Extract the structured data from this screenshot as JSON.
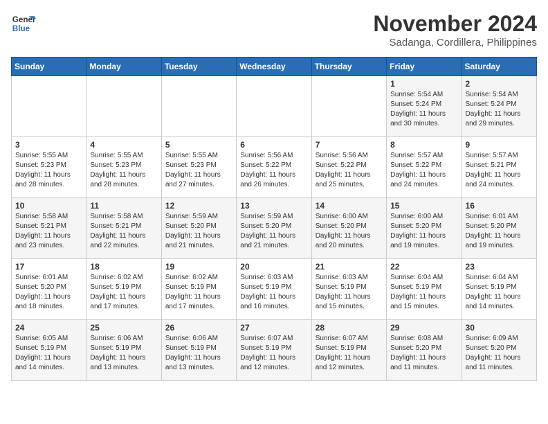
{
  "header": {
    "logo_line1": "General",
    "logo_line2": "Blue",
    "month": "November 2024",
    "location": "Sadanga, Cordillera, Philippines"
  },
  "days_of_week": [
    "Sunday",
    "Monday",
    "Tuesday",
    "Wednesday",
    "Thursday",
    "Friday",
    "Saturday"
  ],
  "weeks": [
    [
      {
        "day": "",
        "info": ""
      },
      {
        "day": "",
        "info": ""
      },
      {
        "day": "",
        "info": ""
      },
      {
        "day": "",
        "info": ""
      },
      {
        "day": "",
        "info": ""
      },
      {
        "day": "1",
        "info": "Sunrise: 5:54 AM\nSunset: 5:24 PM\nDaylight: 11 hours and 30 minutes."
      },
      {
        "day": "2",
        "info": "Sunrise: 5:54 AM\nSunset: 5:24 PM\nDaylight: 11 hours and 29 minutes."
      }
    ],
    [
      {
        "day": "3",
        "info": "Sunrise: 5:55 AM\nSunset: 5:23 PM\nDaylight: 11 hours and 28 minutes."
      },
      {
        "day": "4",
        "info": "Sunrise: 5:55 AM\nSunset: 5:23 PM\nDaylight: 11 hours and 28 minutes."
      },
      {
        "day": "5",
        "info": "Sunrise: 5:55 AM\nSunset: 5:23 PM\nDaylight: 11 hours and 27 minutes."
      },
      {
        "day": "6",
        "info": "Sunrise: 5:56 AM\nSunset: 5:22 PM\nDaylight: 11 hours and 26 minutes."
      },
      {
        "day": "7",
        "info": "Sunrise: 5:56 AM\nSunset: 5:22 PM\nDaylight: 11 hours and 25 minutes."
      },
      {
        "day": "8",
        "info": "Sunrise: 5:57 AM\nSunset: 5:22 PM\nDaylight: 11 hours and 24 minutes."
      },
      {
        "day": "9",
        "info": "Sunrise: 5:57 AM\nSunset: 5:21 PM\nDaylight: 11 hours and 24 minutes."
      }
    ],
    [
      {
        "day": "10",
        "info": "Sunrise: 5:58 AM\nSunset: 5:21 PM\nDaylight: 11 hours and 23 minutes."
      },
      {
        "day": "11",
        "info": "Sunrise: 5:58 AM\nSunset: 5:21 PM\nDaylight: 11 hours and 22 minutes."
      },
      {
        "day": "12",
        "info": "Sunrise: 5:59 AM\nSunset: 5:20 PM\nDaylight: 11 hours and 21 minutes."
      },
      {
        "day": "13",
        "info": "Sunrise: 5:59 AM\nSunset: 5:20 PM\nDaylight: 11 hours and 21 minutes."
      },
      {
        "day": "14",
        "info": "Sunrise: 6:00 AM\nSunset: 5:20 PM\nDaylight: 11 hours and 20 minutes."
      },
      {
        "day": "15",
        "info": "Sunrise: 6:00 AM\nSunset: 5:20 PM\nDaylight: 11 hours and 19 minutes."
      },
      {
        "day": "16",
        "info": "Sunrise: 6:01 AM\nSunset: 5:20 PM\nDaylight: 11 hours and 19 minutes."
      }
    ],
    [
      {
        "day": "17",
        "info": "Sunrise: 6:01 AM\nSunset: 5:20 PM\nDaylight: 11 hours and 18 minutes."
      },
      {
        "day": "18",
        "info": "Sunrise: 6:02 AM\nSunset: 5:19 PM\nDaylight: 11 hours and 17 minutes."
      },
      {
        "day": "19",
        "info": "Sunrise: 6:02 AM\nSunset: 5:19 PM\nDaylight: 11 hours and 17 minutes."
      },
      {
        "day": "20",
        "info": "Sunrise: 6:03 AM\nSunset: 5:19 PM\nDaylight: 11 hours and 16 minutes."
      },
      {
        "day": "21",
        "info": "Sunrise: 6:03 AM\nSunset: 5:19 PM\nDaylight: 11 hours and 15 minutes."
      },
      {
        "day": "22",
        "info": "Sunrise: 6:04 AM\nSunset: 5:19 PM\nDaylight: 11 hours and 15 minutes."
      },
      {
        "day": "23",
        "info": "Sunrise: 6:04 AM\nSunset: 5:19 PM\nDaylight: 11 hours and 14 minutes."
      }
    ],
    [
      {
        "day": "24",
        "info": "Sunrise: 6:05 AM\nSunset: 5:19 PM\nDaylight: 11 hours and 14 minutes."
      },
      {
        "day": "25",
        "info": "Sunrise: 6:06 AM\nSunset: 5:19 PM\nDaylight: 11 hours and 13 minutes."
      },
      {
        "day": "26",
        "info": "Sunrise: 6:06 AM\nSunset: 5:19 PM\nDaylight: 11 hours and 13 minutes."
      },
      {
        "day": "27",
        "info": "Sunrise: 6:07 AM\nSunset: 5:19 PM\nDaylight: 11 hours and 12 minutes."
      },
      {
        "day": "28",
        "info": "Sunrise: 6:07 AM\nSunset: 5:19 PM\nDaylight: 11 hours and 12 minutes."
      },
      {
        "day": "29",
        "info": "Sunrise: 6:08 AM\nSunset: 5:20 PM\nDaylight: 11 hours and 11 minutes."
      },
      {
        "day": "30",
        "info": "Sunrise: 6:09 AM\nSunset: 5:20 PM\nDaylight: 11 hours and 11 minutes."
      }
    ]
  ]
}
